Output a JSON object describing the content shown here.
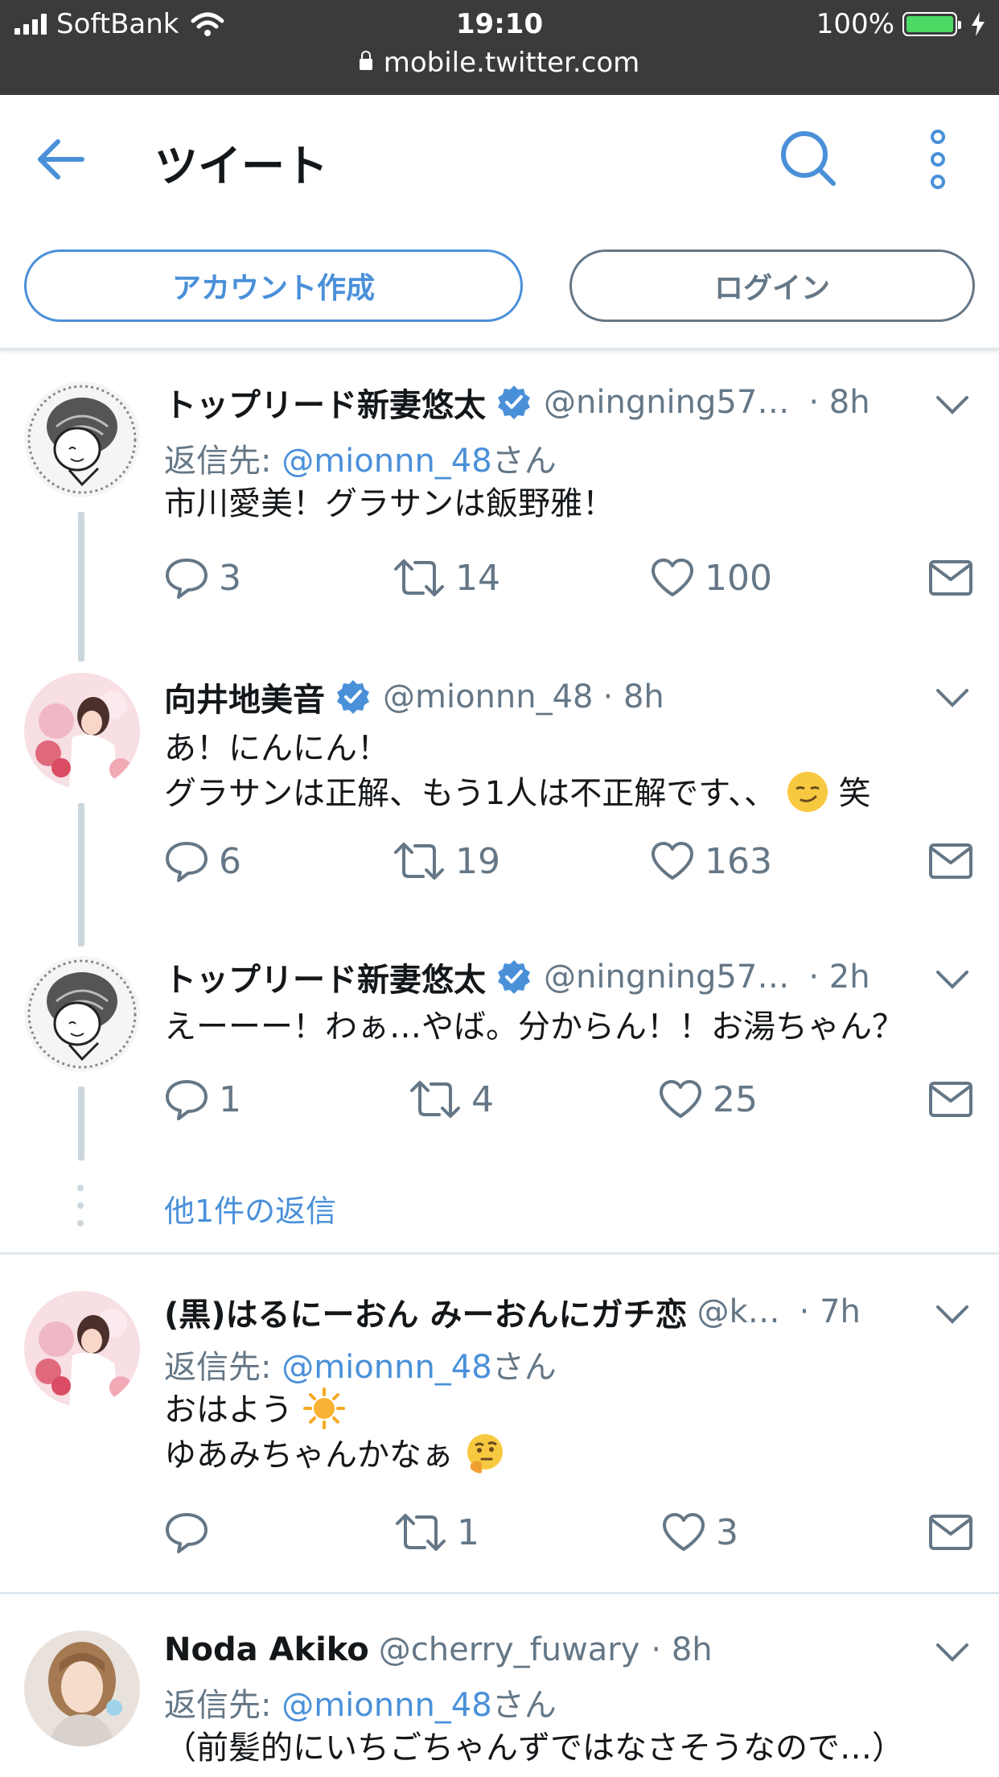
{
  "status": {
    "carrier": "SoftBank",
    "time": "19:10",
    "battery": "100%",
    "battery_level": 1.0,
    "url": "mobile.twitter.com"
  },
  "header": {
    "title": "ツイート",
    "create_account": "アカウント作成",
    "login": "ログイン"
  },
  "colors": {
    "accent": "#4a90d9",
    "muted": "#657786",
    "line": "#ccd6dd"
  },
  "tweets": [
    {
      "name": "トップリード新妻悠太",
      "handle": "@ningning57…",
      "time": "· 8h",
      "reply_prefix": "返信先: ",
      "reply_to": "@mionnn_48",
      "reply_suffix": "さん",
      "text1": "市川愛美！グラサンは飯野雅！",
      "replies": "3",
      "retweets": "14",
      "likes": "100"
    },
    {
      "name": "向井地美音",
      "handle": "@mionnn_48",
      "time": "· 8h",
      "text1": "あ！にんにん！",
      "text2": "グラサンは正解、もう1人は不正解です、、",
      "text2_suffix": "笑",
      "replies": "6",
      "retweets": "19",
      "likes": "163"
    },
    {
      "name": "トップリード新妻悠太",
      "handle": "@ningning57…",
      "time": "· 2h",
      "text1": "えーーー！わぁ…やば。分からん！！お湯ちゃん？",
      "replies": "1",
      "retweets": "4",
      "likes": "25"
    },
    {
      "more_replies": "他1件の返信"
    },
    {
      "name": "(黒)はるにーおん みーおんにガチ恋",
      "handle": "@k…",
      "time": "· 7h",
      "reply_prefix": "返信先: ",
      "reply_to": "@mionnn_48",
      "reply_suffix": "さん",
      "text1": "おはよう",
      "text2": "ゆあみちゃんかなぁ",
      "replies": "",
      "retweets": "1",
      "likes": "3"
    },
    {
      "name": "Noda Akiko",
      "handle": "@cherry_fuwary",
      "time": "· 8h",
      "reply_prefix": "返信先: ",
      "reply_to": "@mionnn_48",
      "reply_suffix": "さん",
      "text1": "（前髪的にいちごちゃんずではなさそうなので…）"
    }
  ]
}
